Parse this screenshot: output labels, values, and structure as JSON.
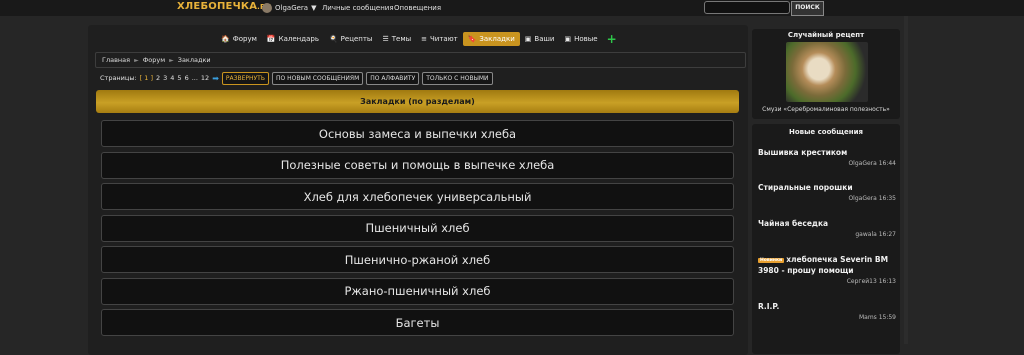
{
  "site": {
    "logo": "ХЛЕБОПЕЧКА",
    "logo_suffix": ".РУ"
  },
  "topbar": {
    "user": "OlgaGera",
    "links": [
      "Личные сообщения",
      "Оповещения"
    ],
    "search_placeholder": "",
    "search_button": "ПОИСК"
  },
  "nav": {
    "items": [
      {
        "label": "Форум",
        "icon": "home-icon"
      },
      {
        "label": "Календарь",
        "icon": "calendar-icon"
      },
      {
        "label": "Рецепты",
        "icon": "recipes-icon"
      },
      {
        "label": "Темы",
        "icon": "topics-icon"
      },
      {
        "label": "Читают",
        "icon": "readers-icon"
      },
      {
        "label": "Закладки",
        "icon": "bookmark-icon",
        "active": true
      },
      {
        "label": "Ваши",
        "icon": "yours-icon"
      },
      {
        "label": "Новые",
        "icon": "new-icon"
      }
    ]
  },
  "breadcrumb": [
    "Главная",
    "Форум",
    "Закладки"
  ],
  "pager": {
    "label": "Страницы:",
    "current": "[ 1 ]",
    "pages": [
      "2",
      "3",
      "4",
      "5",
      "6",
      "...",
      "12"
    ],
    "buttons": [
      "РАЗВЕРНУТЬ",
      "ПО НОВЫМ СООБЩЕНИЯМ",
      "ПО АЛФАВИТУ",
      "ТОЛЬКО С НОВЫМИ"
    ]
  },
  "category_header": "Закладки (по разделам)",
  "forums": [
    "Основы замеса и выпечки хлеба",
    "Полезные советы и помощь в выпечке хлеба",
    "Хлеб для хлебопечек универсальный",
    "Пшеничный хлеб",
    "Пшенично-ржаной хлеб",
    "Ржано-пшеничный хлеб",
    "Багеты"
  ],
  "sidebar": {
    "random_title": "Случайный рецепт",
    "random_caption": "Смузи «Серебромалиновая полезность»",
    "new_title": "Новые сообщения",
    "new_items": [
      {
        "topic": "Вышивка крестиком",
        "meta": "OlgaGera 16:44"
      },
      {
        "topic": "Стиральные порошки",
        "meta": "OlgaGera 16:35"
      },
      {
        "topic": "Чайная беседка",
        "meta": "gawala 16:27"
      },
      {
        "badge": "Новинки",
        "topic": "хлебопечка Severin BM 3980 - прошу помощи",
        "meta": "Сергей13 16:13"
      },
      {
        "topic": "R.I.P.",
        "meta": "Mams 15:59"
      }
    ]
  }
}
